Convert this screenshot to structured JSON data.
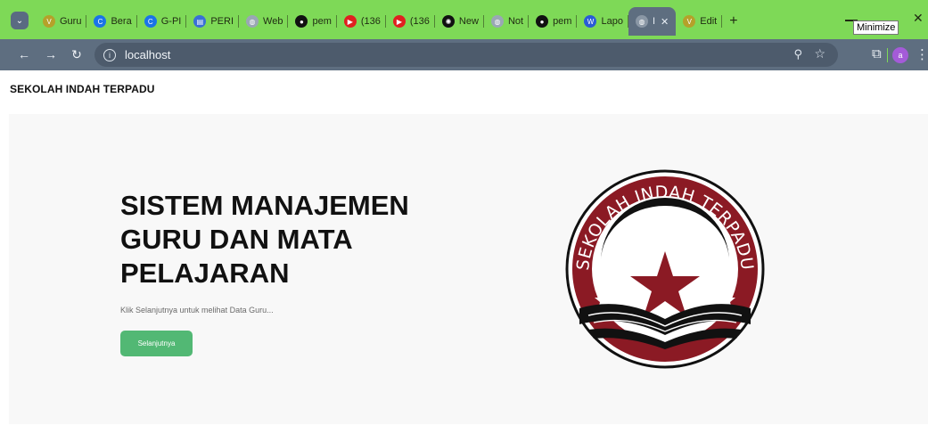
{
  "browser": {
    "tabs": [
      {
        "label": "Guru",
        "icon": "vuetify-icon",
        "color": "#b5a12a"
      },
      {
        "label": "Bera",
        "icon": "canva-icon",
        "color": "#1a73e8"
      },
      {
        "label": "G-PI",
        "icon": "canva-icon",
        "color": "#1a73e8"
      },
      {
        "label": "PERI",
        "icon": "printer-icon",
        "color": "#3a6fd6"
      },
      {
        "label": "Web",
        "icon": "globe-icon",
        "color": "#9aa7b4"
      },
      {
        "label": "pem",
        "icon": "github-icon",
        "color": "#111111"
      },
      {
        "label": "(136",
        "icon": "youtube-icon",
        "color": "#e02020"
      },
      {
        "label": "(136",
        "icon": "youtube-icon",
        "color": "#e02020"
      },
      {
        "label": "New",
        "icon": "chatgpt-icon",
        "color": "#111111"
      },
      {
        "label": "Not",
        "icon": "globe-icon",
        "color": "#9aa7b4"
      },
      {
        "label": "pem",
        "icon": "github-icon",
        "color": "#111111"
      },
      {
        "label": "Lapo",
        "icon": "word-icon",
        "color": "#2a5bd7"
      }
    ],
    "active_tab": {
      "label": "I",
      "close": "✕"
    },
    "after_tab": {
      "label": "Edit",
      "icon": "vuetify-icon",
      "color": "#b5a12a"
    },
    "new_tab": "+",
    "tooltip": "Minimize",
    "close_glyph": "✕",
    "address": "localhost",
    "profile_initial": "a"
  },
  "page": {
    "brand": "SEKOLAH INDAH TERPADU",
    "hero_title": "SISTEM MANAJEMEN GURU DAN MATA PELAJARAN",
    "hero_text": "Klik Selanjutnya untuk melihat Data Guru...",
    "hero_button": "Selanjutnya",
    "logo_text": "SEKOLAH INDAH TERPADU"
  },
  "colors": {
    "tabstrip": "#7ed957",
    "toolbar": "#5e6e80",
    "button": "#52b874",
    "logo_red": "#8b1a24"
  }
}
